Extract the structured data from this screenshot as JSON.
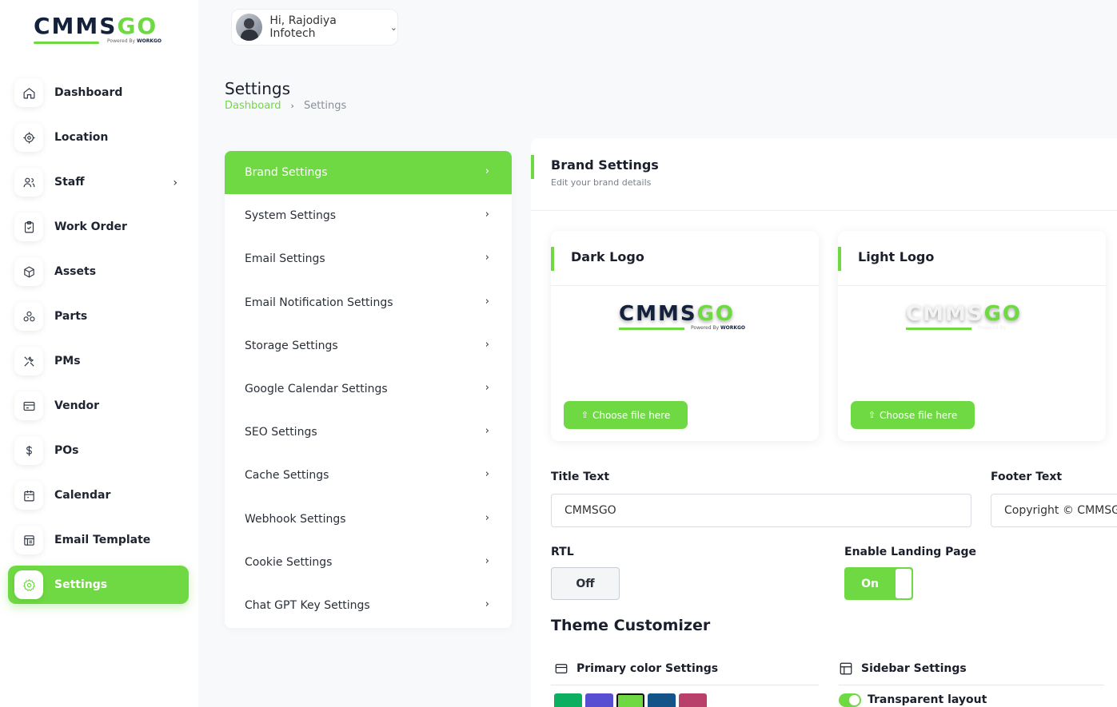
{
  "brand": {
    "logo_main": "CMMS",
    "logo_accent": "GO",
    "powered_by": "Powered By",
    "powered_brand": "WORKGO"
  },
  "sidebar": {
    "items": [
      {
        "label": "Dashboard",
        "icon": "home-icon"
      },
      {
        "label": "Location",
        "icon": "location-icon"
      },
      {
        "label": "Staff",
        "icon": "users-icon"
      },
      {
        "label": "Work Order",
        "icon": "clipboard-icon"
      },
      {
        "label": "Assets",
        "icon": "box-icon"
      },
      {
        "label": "Parts",
        "icon": "parts-icon"
      },
      {
        "label": "PMs",
        "icon": "tools-icon"
      },
      {
        "label": "Vendor",
        "icon": "card-icon"
      },
      {
        "label": "POs",
        "icon": "dollar-icon"
      },
      {
        "label": "Calendar",
        "icon": "calendar-icon"
      },
      {
        "label": "Email Template",
        "icon": "template-icon"
      },
      {
        "label": "Settings",
        "icon": "gear-icon"
      }
    ],
    "active": "Settings"
  },
  "header": {
    "greeting": "Hi, Rajodiya Infotech"
  },
  "page": {
    "title": "Settings",
    "breadcrumb_home": "Dashboard",
    "breadcrumb_current": "Settings"
  },
  "settings_menu": [
    "Brand Settings",
    "System Settings",
    "Email Settings",
    "Email Notification Settings",
    "Storage Settings",
    "Google Calendar Settings",
    "SEO Settings",
    "Cache Settings",
    "Webhook Settings",
    "Cookie Settings",
    "Chat GPT Key Settings"
  ],
  "brand_settings": {
    "title": "Brand Settings",
    "subtitle": "Edit your brand details",
    "dark_logo_label": "Dark Logo",
    "light_logo_label": "Light Logo",
    "choose_file_label": "Choose file here",
    "title_text_label": "Title Text",
    "title_text_value": "CMMSGO",
    "footer_text_label": "Footer Text",
    "footer_text_value": "Copyright © CMMSGO",
    "rtl_label": "RTL",
    "rtl_state": "Off",
    "landing_label": "Enable Landing Page",
    "landing_state": "On"
  },
  "theme": {
    "title": "Theme Customizer",
    "primary_color_label": "Primary color Settings",
    "sidebar_settings_label": "Sidebar Settings",
    "transparent_layout_label": "Transparent layout",
    "swatches": [
      "#0caf60",
      "#584ed2",
      "#6fd943",
      "#145388",
      "#b9406b"
    ],
    "selected_swatch": "#6fd943"
  },
  "colors": {
    "accent": "#6fd943",
    "navy": "#14213d"
  }
}
